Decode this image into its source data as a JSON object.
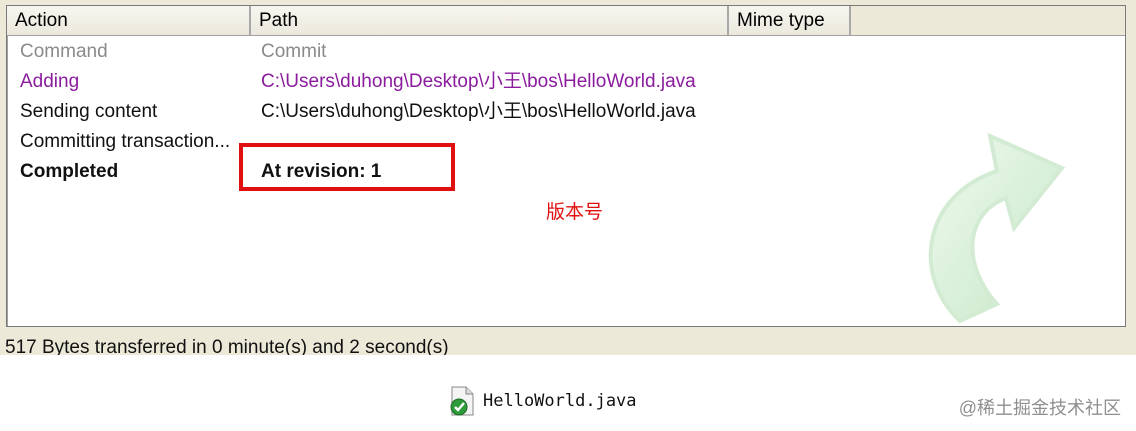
{
  "columns": {
    "action": "Action",
    "path": "Path",
    "mime": "Mime type"
  },
  "rows": [
    {
      "action": "Command",
      "path": "Commit",
      "style": "gray"
    },
    {
      "action": "Adding",
      "path": "C:\\Users\\duhong\\Desktop\\小王\\bos\\HelloWorld.java",
      "style": "purple"
    },
    {
      "action": "Sending content",
      "path": "C:\\Users\\duhong\\Desktop\\小王\\bos\\HelloWorld.java",
      "style": "black"
    },
    {
      "action": "Committing transaction...",
      "path": "",
      "style": "black"
    },
    {
      "action": "Completed",
      "path": "At revision: 1",
      "style": "bold"
    }
  ],
  "annotation": "版本号",
  "status": "517 Bytes transferred in 0 minute(s) and 2 second(s)",
  "file": {
    "name": "HelloWorld.java",
    "icon": "java-file-committed-icon"
  },
  "watermark": "@稀土掘金技术社区",
  "colors": {
    "annotation": "#e01010",
    "adding": "#8b1c9e",
    "arrow": "#bfe8bf"
  }
}
